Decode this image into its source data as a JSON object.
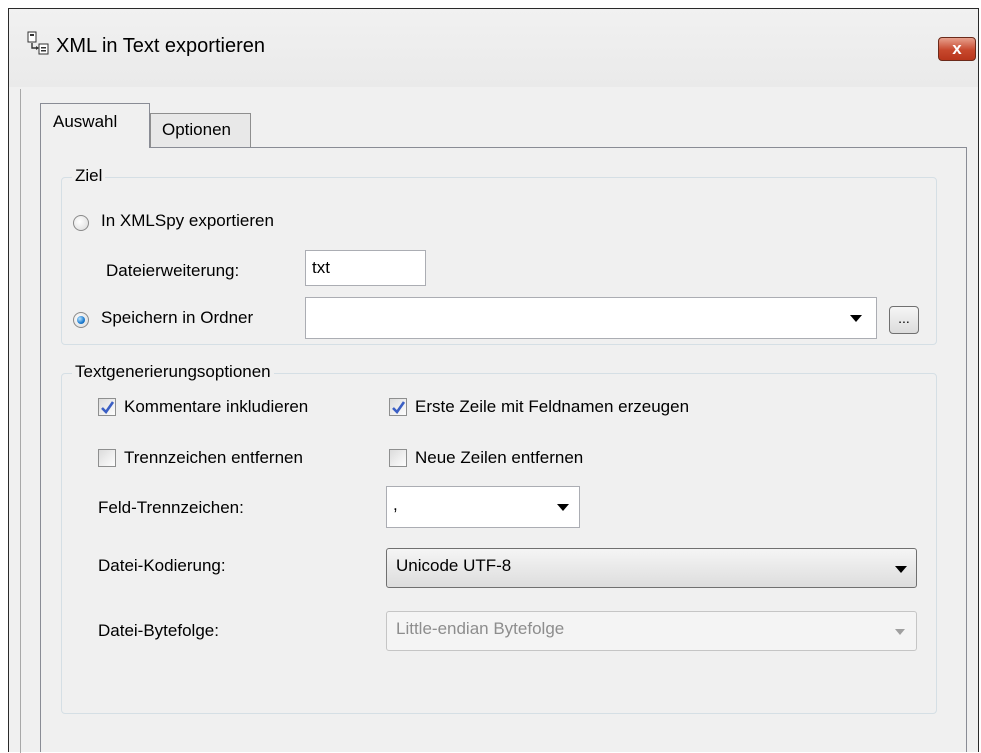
{
  "window": {
    "title": "XML in Text exportieren",
    "close_label": "x",
    "icon": "xml-to-text-icon"
  },
  "tabs": [
    {
      "label": "Auswahl",
      "active": true
    },
    {
      "label": "Optionen",
      "active": false
    }
  ],
  "ziel": {
    "group_label": "Ziel",
    "option_xmlspy": {
      "label": "In XMLSpy exportieren",
      "selected": false
    },
    "file_ext_label": "Dateierweiterung:",
    "file_ext_value": "txt",
    "option_folder": {
      "label": "Speichern in Ordner",
      "selected": true
    },
    "folder_value": "",
    "browse_label": "..."
  },
  "textgen": {
    "group_label": "Textgenerierungsoptionen",
    "checkboxes": [
      {
        "label": "Kommentare inkludieren",
        "checked": true
      },
      {
        "label": "Erste Zeile mit Feldnamen erzeugen",
        "checked": true
      },
      {
        "label": "Trennzeichen entfernen",
        "checked": false
      },
      {
        "label": "Neue Zeilen entfernen",
        "checked": false
      }
    ],
    "field_sep_label": "Feld-Trennzeichen:",
    "field_sep_value": ",",
    "encoding_label": "Datei-Kodierung:",
    "encoding_value": "Unicode UTF-8",
    "byteorder_label": "Datei-Bytefolge:",
    "byteorder_value": "Little-endian Bytefolge"
  },
  "colors": {
    "accent_radio": "#1c7bd0",
    "checkmark": "#3b5fc4",
    "close_button": "#c7482d"
  }
}
